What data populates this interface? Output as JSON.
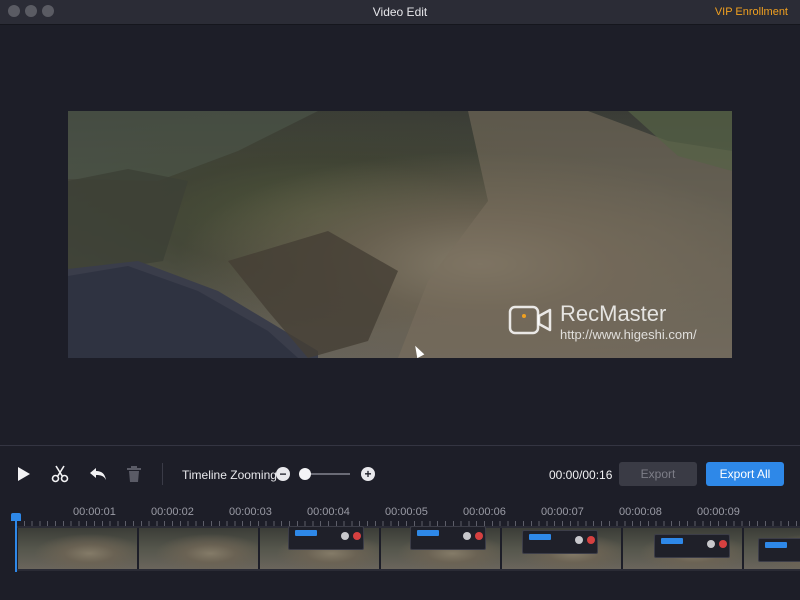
{
  "window": {
    "title": "Video Edit",
    "vip_label": "VIP Enrollment"
  },
  "preview": {
    "watermark_name": "RecMaster",
    "watermark_url": "http://www.higeshi.com/"
  },
  "toolbar": {
    "zoom_label": "Timeline Zooming",
    "zoom_out_symbol": "−",
    "zoom_in_symbol": "+",
    "zoom_level": 0,
    "time_display": "00:00/00:16",
    "export_label": "Export",
    "export_all_label": "Export All",
    "icons": [
      "play-icon",
      "scissors-icon",
      "undo-icon",
      "trash-icon"
    ]
  },
  "timeline": {
    "ruler_labels": [
      "00:00:01",
      "00:00:02",
      "00:00:03",
      "00:00:04",
      "00:00:05",
      "00:00:06",
      "00:00:07",
      "00:00:08",
      "00:00:09"
    ],
    "playhead_time": "00:00:00"
  },
  "colors": {
    "accent": "#2e88e8",
    "vip": "#f0a020",
    "background": "#1d1e28"
  }
}
